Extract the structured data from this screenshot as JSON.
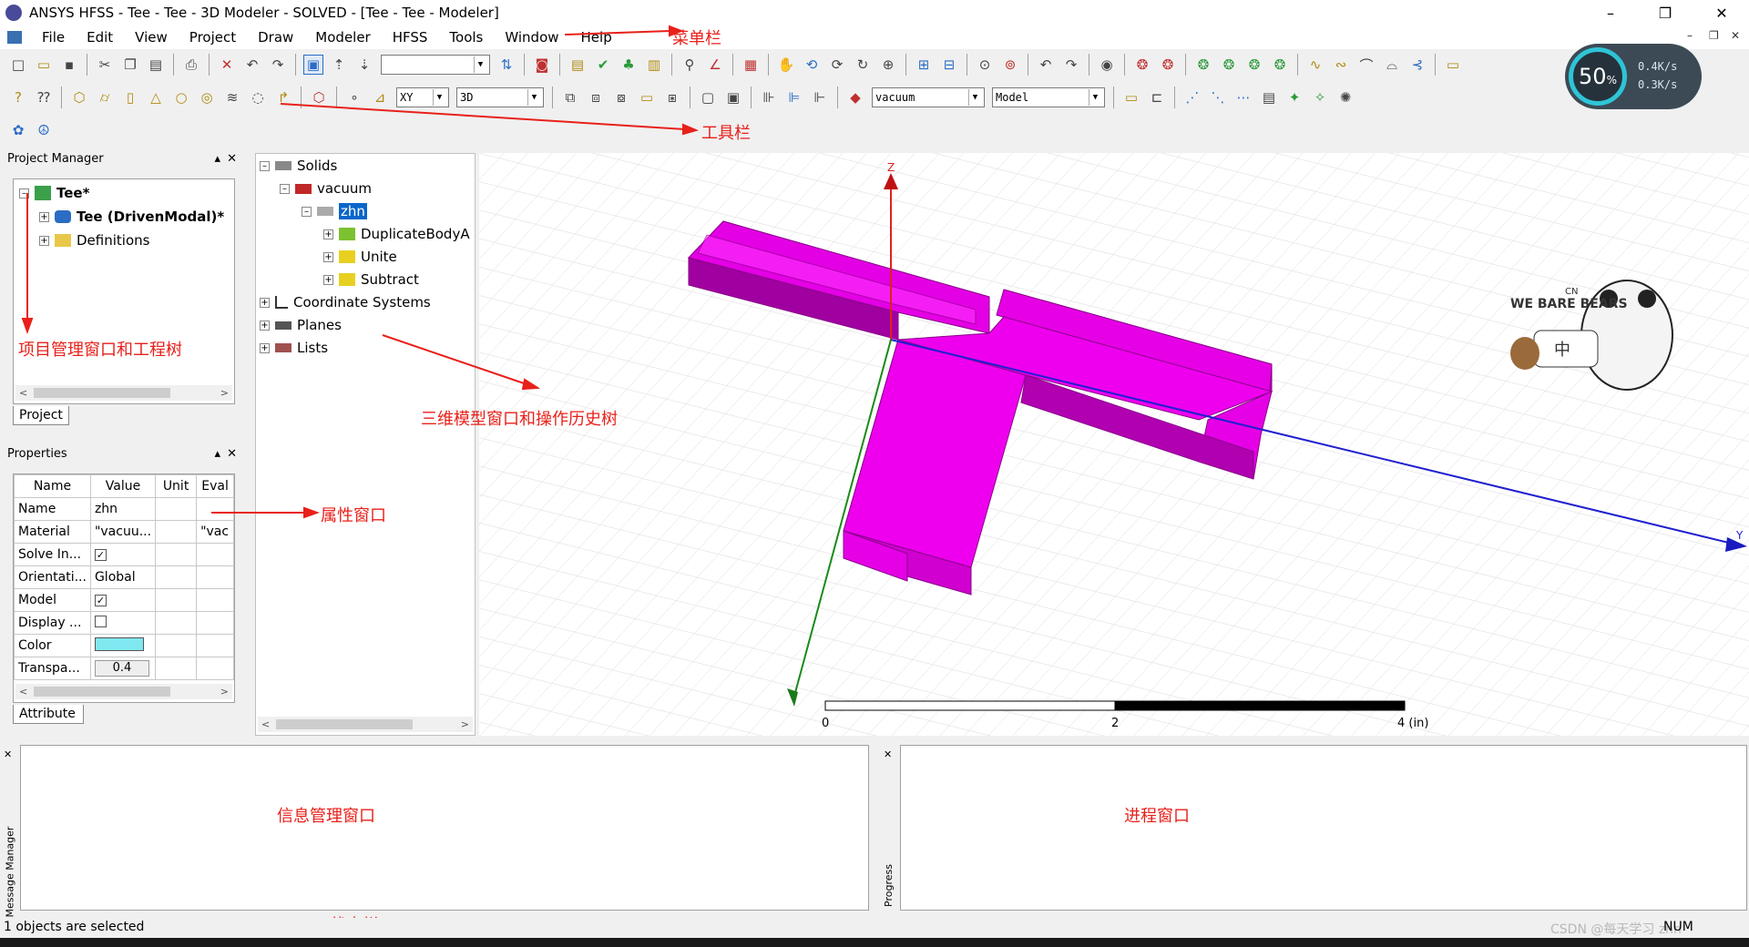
{
  "window": {
    "title": "ANSYS HFSS - Tee - Tee - 3D Modeler - SOLVED - [Tee - Tee - Modeler]",
    "minimize": "–",
    "restore": "❐",
    "close": "✕"
  },
  "menu": {
    "items": [
      "File",
      "Edit",
      "View",
      "Project",
      "Draw",
      "Modeler",
      "HFSS",
      "Tools",
      "Window",
      "Help"
    ],
    "mdi": [
      "–",
      "❐",
      "✕"
    ]
  },
  "toolbar": {
    "blank_combo": "",
    "plane_combo": "XY",
    "mode_combo": "3D",
    "material_combo": "vacuum",
    "model_combo": "Model"
  },
  "project_manager": {
    "header": "Project Manager",
    "tree": [
      {
        "label": "Tee*",
        "bold": true
      },
      {
        "label": "Tee (DrivenModal)*",
        "bold": true
      },
      {
        "label": "Definitions",
        "bold": false
      }
    ],
    "tab": "Project"
  },
  "properties": {
    "header": "Properties",
    "columns": [
      "Name",
      "Value",
      "Unit",
      "Eval"
    ],
    "rows": [
      {
        "name": "Name",
        "value": "zhn",
        "unit": "",
        "eval": ""
      },
      {
        "name": "Material",
        "value": "\"vacuu...",
        "unit": "",
        "eval": "\"vac"
      },
      {
        "name": "Solve In...",
        "value": "✓",
        "unit": "",
        "eval": ""
      },
      {
        "name": "Orientati...",
        "value": "Global",
        "unit": "",
        "eval": ""
      },
      {
        "name": "Model",
        "value": "✓",
        "unit": "",
        "eval": ""
      },
      {
        "name": "Display ...",
        "value": "",
        "unit": "",
        "eval": ""
      },
      {
        "name": "Color",
        "value": "",
        "unit": "",
        "eval": ""
      },
      {
        "name": "Transpa...",
        "value": "0.4",
        "unit": "",
        "eval": ""
      }
    ],
    "color_swatch": "#7fe8f0",
    "tab": "Attribute"
  },
  "history_tree": {
    "items": [
      {
        "label": "Solids",
        "indent": 0
      },
      {
        "label": "vacuum",
        "indent": 1
      },
      {
        "label": "zhn",
        "indent": 2,
        "selected": true
      },
      {
        "label": "DuplicateBodyA",
        "indent": 3
      },
      {
        "label": "Unite",
        "indent": 3
      },
      {
        "label": "Subtract",
        "indent": 3
      },
      {
        "label": "Coordinate Systems",
        "indent": 0
      },
      {
        "label": "Planes",
        "indent": 0
      },
      {
        "label": "Lists",
        "indent": 0
      }
    ]
  },
  "viewport": {
    "axis_z": "Z",
    "axis_y": "Y",
    "scale_labels": [
      "0",
      "2",
      "4 (in)"
    ],
    "model_color": "#e600e6",
    "model_edge": "#8a008a"
  },
  "annotations": {
    "menubar": "菜单栏",
    "toolbar": "工具栏",
    "project_tree": "项目管理窗口和工程树",
    "model_window": "三维模型窗口和操作历史树",
    "properties": "属性窗口",
    "message": "信息管理窗口",
    "progress": "进程窗口",
    "statusbar": "状态栏"
  },
  "message_manager": {
    "label": "Message Manager"
  },
  "progress": {
    "label": "Progress"
  },
  "status": {
    "text": "1 objects are selected",
    "num": "NUM",
    "watermark": "CSDN @每天学习 zhn"
  },
  "speed_widget": {
    "percent": "50",
    "unit": "%",
    "up": "0.4K/s",
    "down": "0.3K/s"
  },
  "sticker": {
    "brand": "WE BARE BEARS",
    "top": "CN",
    "chars": "中"
  }
}
